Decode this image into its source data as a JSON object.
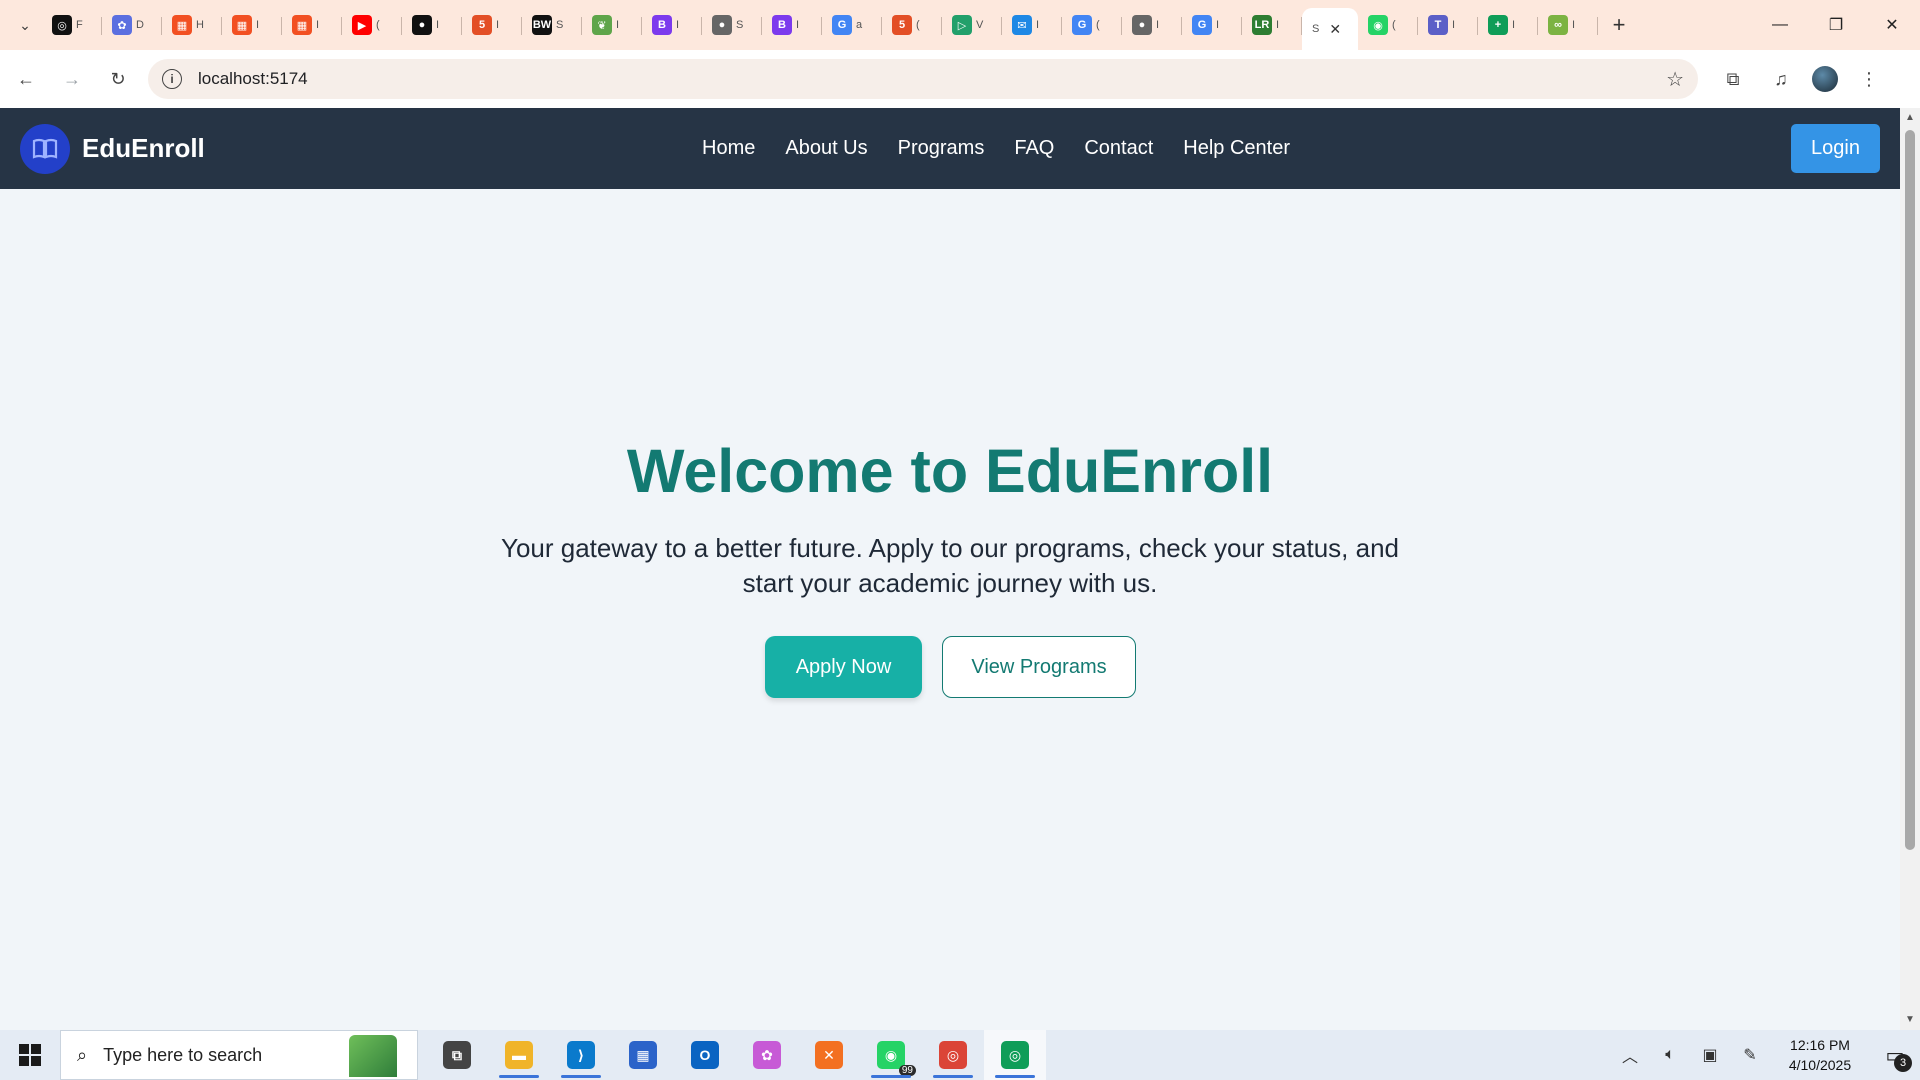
{
  "browser": {
    "tabs": [
      {
        "icon": "openai-icon",
        "color": "#111111",
        "glyph": "◎",
        "tail": "F"
      },
      {
        "icon": "copilot-icon",
        "color": "#5b6fe0",
        "glyph": "✿",
        "tail": "D"
      },
      {
        "icon": "microsoft-icon",
        "color": "#f25022",
        "glyph": "▦",
        "tail": "H"
      },
      {
        "icon": "microsoft-icon",
        "color": "#f25022",
        "glyph": "▦",
        "tail": "I"
      },
      {
        "icon": "microsoft-icon",
        "color": "#f25022",
        "glyph": "▦",
        "tail": "I"
      },
      {
        "icon": "youtube-icon",
        "color": "#ff0000",
        "glyph": "▶",
        "tail": "("
      },
      {
        "icon": "github-icon",
        "color": "#111111",
        "glyph": "●",
        "tail": "I"
      },
      {
        "icon": "html5-icon",
        "color": "#e34f26",
        "glyph": "5",
        "tail": "I"
      },
      {
        "icon": "bw-icon",
        "color": "#111111",
        "glyph": "BW",
        "tail": "S"
      },
      {
        "icon": "leaf-icon",
        "color": "#5fa54a",
        "glyph": "❦",
        "tail": "I"
      },
      {
        "icon": "bootstrap-icon",
        "color": "#7c3aed",
        "glyph": "B",
        "tail": "I"
      },
      {
        "icon": "globe-icon",
        "color": "#666666",
        "glyph": "●",
        "tail": "S"
      },
      {
        "icon": "bootstrap-icon",
        "color": "#7c3aed",
        "glyph": "B",
        "tail": "I"
      },
      {
        "icon": "google-icon",
        "color": "#4285f4",
        "glyph": "G",
        "tail": "a"
      },
      {
        "icon": "html5-icon",
        "color": "#e34f26",
        "glyph": "5",
        "tail": "("
      },
      {
        "icon": "play-icon",
        "color": "#22a06b",
        "glyph": "▷",
        "tail": "V"
      },
      {
        "icon": "chat-icon",
        "color": "#1e88e5",
        "glyph": "✉",
        "tail": "I"
      },
      {
        "icon": "google-icon",
        "color": "#4285f4",
        "glyph": "G",
        "tail": "("
      },
      {
        "icon": "globe-icon",
        "color": "#666666",
        "glyph": "●",
        "tail": "I"
      },
      {
        "icon": "google-icon",
        "color": "#4285f4",
        "glyph": "G",
        "tail": "I"
      },
      {
        "icon": "lr-icon",
        "color": "#2e7d32",
        "glyph": "LR",
        "tail": "I"
      }
    ],
    "active_tab": {
      "tail": "S"
    },
    "tabs_after": [
      {
        "icon": "whatsapp-icon",
        "color": "#25d366",
        "glyph": "◉",
        "tail": "("
      },
      {
        "icon": "teams-icon",
        "color": "#5b5fc7",
        "glyph": "T",
        "tail": "I"
      },
      {
        "icon": "sheets-icon",
        "color": "#0f9d58",
        "glyph": "+",
        "tail": "I"
      },
      {
        "icon": "link-icon",
        "color": "#7cb342",
        "glyph": "∞",
        "tail": "I"
      }
    ],
    "url": "localhost:5174"
  },
  "site": {
    "brand": "EduEnroll",
    "nav": [
      "Home",
      "About Us",
      "Programs",
      "FAQ",
      "Contact",
      "Help Center"
    ],
    "login": "Login",
    "hero": {
      "title": "Welcome to EduEnroll",
      "subtitle": "Your gateway to a better future. Apply to our programs, check your status, and start your academic journey with us.",
      "primary_cta": "Apply Now",
      "secondary_cta": "View Programs"
    },
    "colors": {
      "nav_bg": "#263445",
      "accent": "#137a72",
      "primary_btn": "#17b0a6",
      "login_btn": "#3494e6"
    }
  },
  "taskbar": {
    "search_placeholder": "Type here to search",
    "apps": [
      {
        "name": "task-view-icon",
        "color": "#444444",
        "glyph": "⧉",
        "running": false
      },
      {
        "name": "file-explorer-icon",
        "color": "#f0b429",
        "glyph": "▬",
        "running": true
      },
      {
        "name": "vscode-icon",
        "color": "#0a7acc",
        "glyph": "⟩",
        "running": true
      },
      {
        "name": "store-icon",
        "color": "#2b63c9",
        "glyph": "▦",
        "running": false
      },
      {
        "name": "outlook-icon",
        "color": "#0a64c2",
        "glyph": "O",
        "running": false
      },
      {
        "name": "copilot-icon",
        "color": "#c75ad6",
        "glyph": "✿",
        "running": false
      },
      {
        "name": "xampp-icon",
        "color": "#f37021",
        "glyph": "✕",
        "running": false
      },
      {
        "name": "whatsapp-icon",
        "color": "#25d366",
        "glyph": "◉",
        "running": true,
        "count": "99"
      },
      {
        "name": "chrome-icon",
        "color": "#db4437",
        "glyph": "◎",
        "running": true
      },
      {
        "name": "chrome-icon",
        "color": "#0f9d58",
        "glyph": "◎",
        "running": true,
        "active": true
      }
    ],
    "time": "12:16 PM",
    "date": "4/10/2025",
    "notifications": "3"
  }
}
